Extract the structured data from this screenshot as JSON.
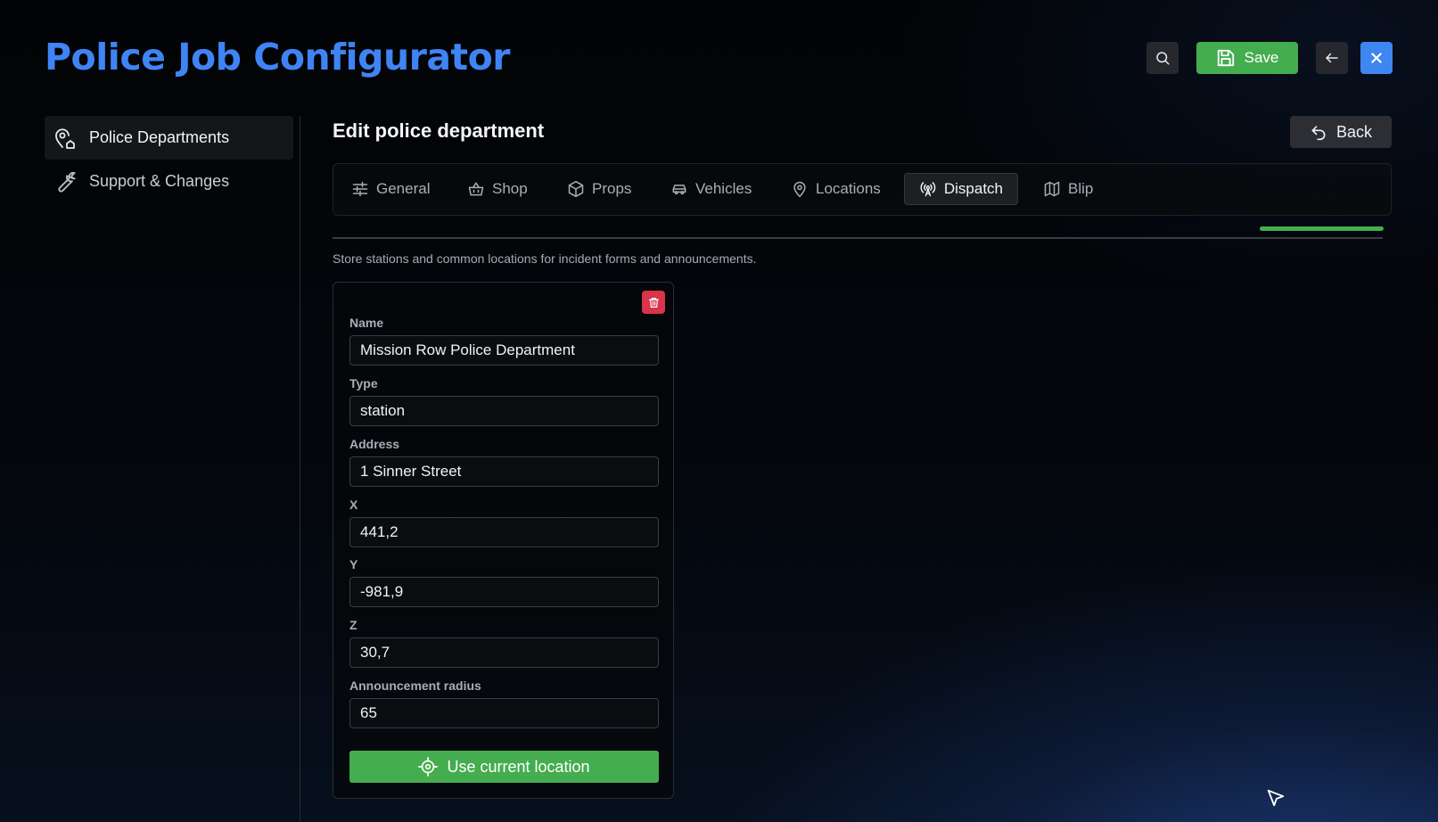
{
  "header": {
    "title": "Police Job Configurator",
    "save_label": "Save",
    "icons": [
      "search-icon",
      "save-icon",
      "arrow-left-icon",
      "close-icon"
    ]
  },
  "sidebar": {
    "items": [
      {
        "label": "Police Departments",
        "icon": "building-pin-icon",
        "active": true
      },
      {
        "label": "Support & Changes",
        "icon": "wrench-icon",
        "active": false
      }
    ]
  },
  "main": {
    "title": "Edit police department",
    "back_label": "Back",
    "tabs": [
      {
        "label": "General",
        "icon": "sliders-icon"
      },
      {
        "label": "Shop",
        "icon": "basket-icon"
      },
      {
        "label": "Props",
        "icon": "box-icon"
      },
      {
        "label": "Vehicles",
        "icon": "car-icon"
      },
      {
        "label": "Locations",
        "icon": "map-pin-icon"
      },
      {
        "label": "Dispatch",
        "icon": "radio-tower-icon",
        "active": true
      },
      {
        "label": "Blip",
        "icon": "map-icon"
      }
    ],
    "description": "Store stations and common locations for incident forms and announcements.",
    "location": {
      "name_label": "Name",
      "name_value": "Mission Row Police Department",
      "type_label": "Type",
      "type_value": "station",
      "address_label": "Address",
      "address_value": "1 Sinner Street",
      "x_label": "X",
      "x_value": "441,2",
      "y_label": "Y",
      "y_value": "-981,9",
      "z_label": "Z",
      "z_value": "30,7",
      "radius_label": "Announcement radius",
      "radius_value": "65",
      "use_location_label": "Use current location"
    }
  },
  "colors": {
    "accent_blue": "#3f84f5",
    "save_green": "#44ad4f",
    "delete_red": "#d8344a",
    "close_blue": "#3f86f0"
  }
}
